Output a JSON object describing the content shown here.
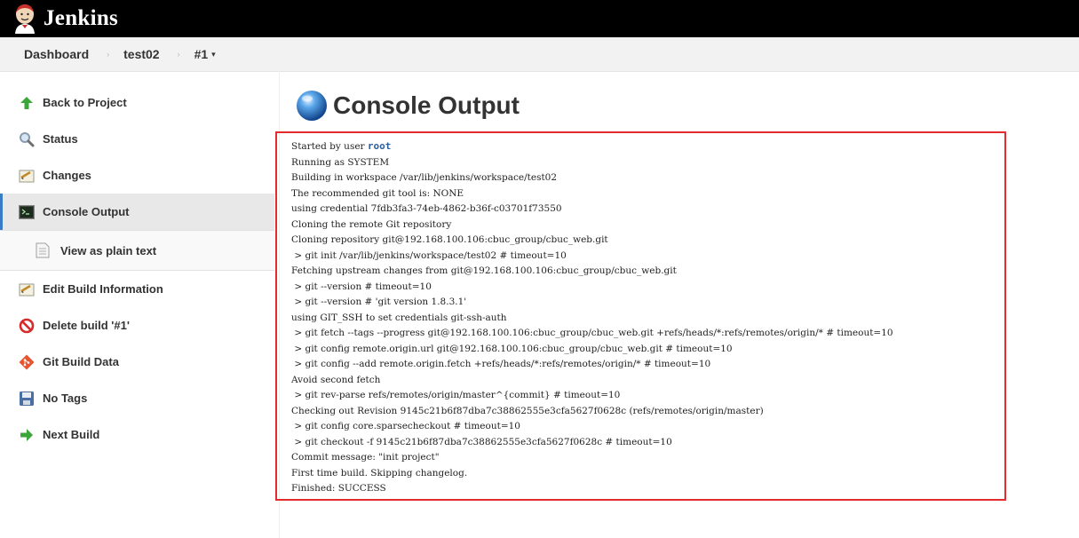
{
  "header": {
    "brand": "Jenkins"
  },
  "breadcrumb": {
    "dashboard": "Dashboard",
    "job": "test02",
    "build": "#1",
    "separator": "›",
    "caret": "▾"
  },
  "sidebar": {
    "items": [
      {
        "label": "Back to Project",
        "icon": "up-arrow-icon"
      },
      {
        "label": "Status",
        "icon": "search-icon"
      },
      {
        "label": "Changes",
        "icon": "notepad-icon"
      },
      {
        "label": "Console Output",
        "icon": "terminal-icon"
      },
      {
        "label": "View as plain text",
        "icon": "document-icon"
      },
      {
        "label": "Edit Build Information",
        "icon": "notepad-icon"
      },
      {
        "label": "Delete build '#1'",
        "icon": "no-entry-icon"
      },
      {
        "label": "Git Build Data",
        "icon": "git-icon"
      },
      {
        "label": "No Tags",
        "icon": "save-icon"
      },
      {
        "label": "Next Build",
        "icon": "right-arrow-icon"
      }
    ]
  },
  "main": {
    "title": "Console Output",
    "started_prefix": "Started by user ",
    "started_user": "root",
    "log_lines": [
      "Running as SYSTEM",
      "Building in workspace /var/lib/jenkins/workspace/test02",
      "The recommended git tool is: NONE",
      "using credential 7fdb3fa3-74eb-4862-b36f-c03701f73550",
      "Cloning the remote Git repository",
      "Cloning repository git@192.168.100.106:cbuc_group/cbuc_web.git",
      " > git init /var/lib/jenkins/workspace/test02 # timeout=10",
      "Fetching upstream changes from git@192.168.100.106:cbuc_group/cbuc_web.git",
      " > git --version # timeout=10",
      " > git --version # 'git version 1.8.3.1'",
      "using GIT_SSH to set credentials git-ssh-auth",
      " > git fetch --tags --progress git@192.168.100.106:cbuc_group/cbuc_web.git +refs/heads/*:refs/remotes/origin/* # timeout=10",
      " > git config remote.origin.url git@192.168.100.106:cbuc_group/cbuc_web.git # timeout=10",
      " > git config --add remote.origin.fetch +refs/heads/*:refs/remotes/origin/* # timeout=10",
      "Avoid second fetch",
      " > git rev-parse refs/remotes/origin/master^{commit} # timeout=10",
      "Checking out Revision 9145c21b6f87dba7c38862555e3cfa5627f0628c (refs/remotes/origin/master)",
      " > git config core.sparsecheckout # timeout=10",
      " > git checkout -f 9145c21b6f87dba7c38862555e3cfa5627f0628c # timeout=10",
      "Commit message: \"init project\"",
      "First time build. Skipping changelog.",
      "Finished: SUCCESS"
    ]
  },
  "colors": {
    "accent": "#3b7cc6",
    "highlight_border": "#e32d2d",
    "header_bg": "#000000"
  }
}
